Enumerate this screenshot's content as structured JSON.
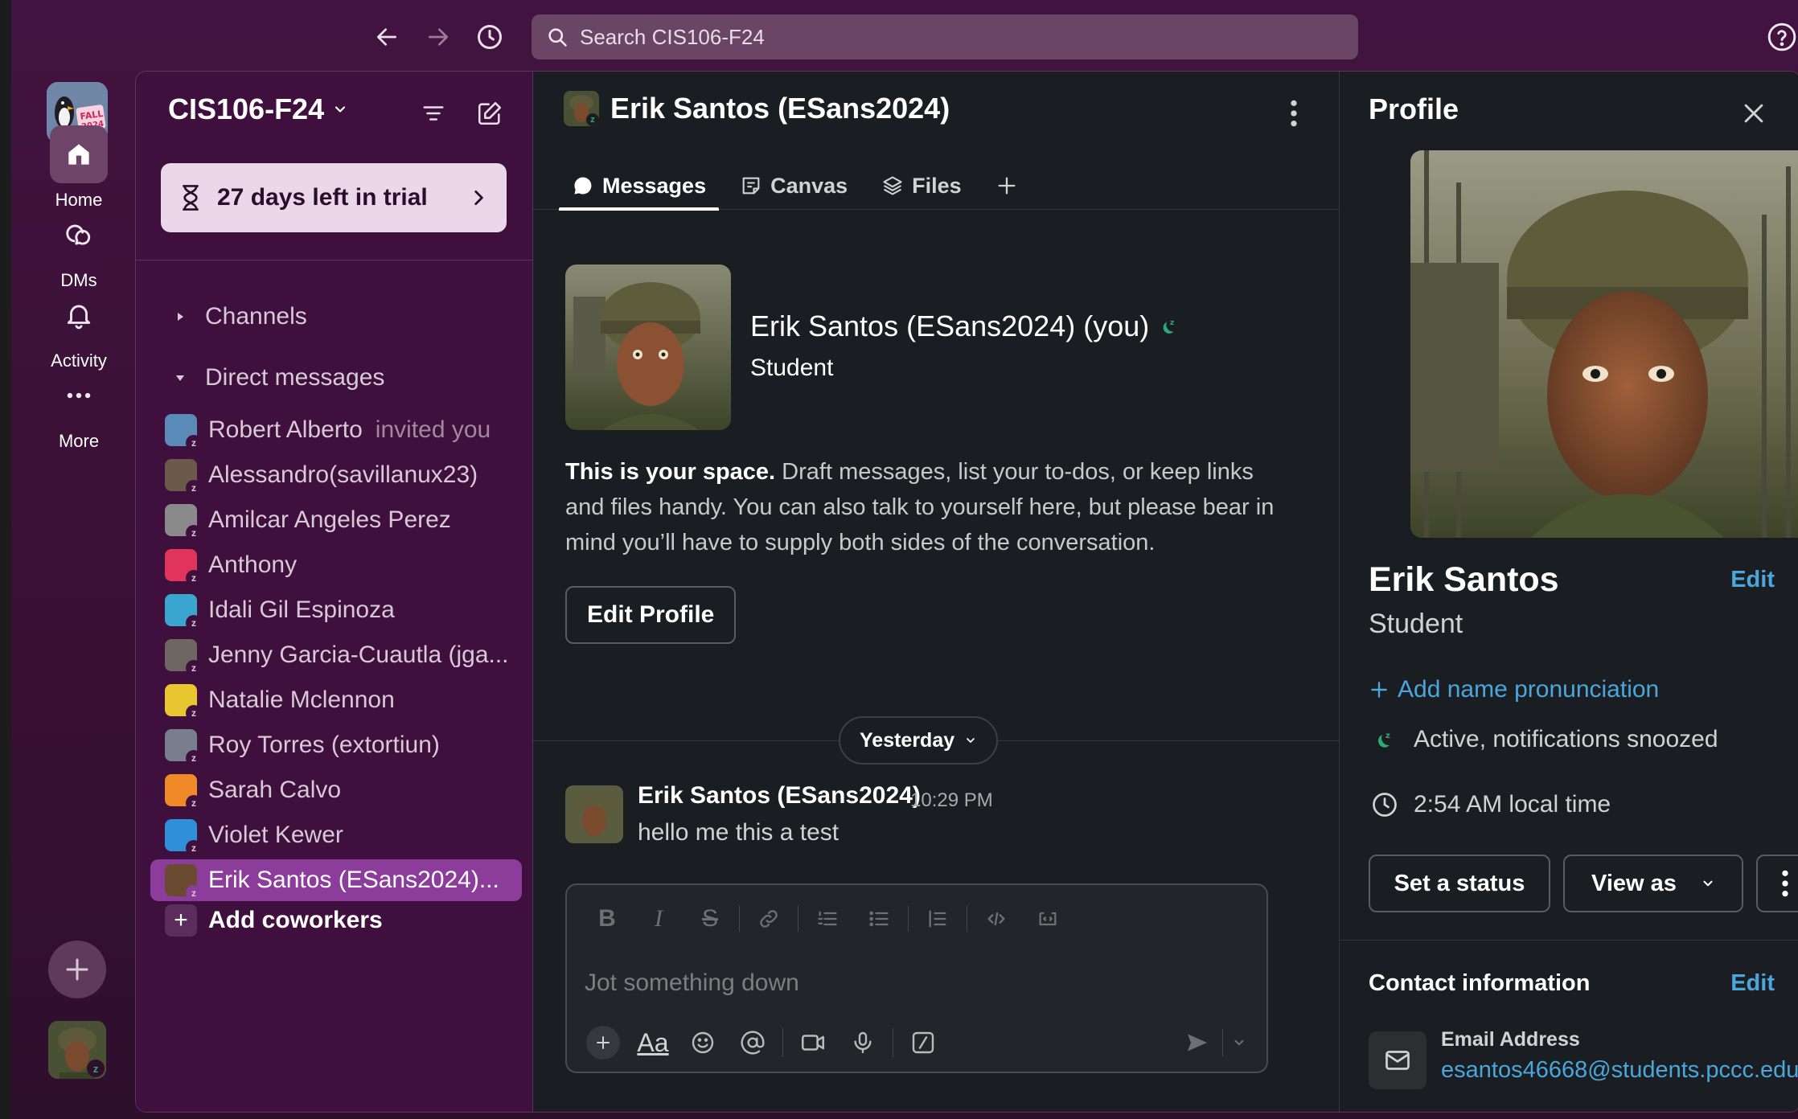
{
  "search": {
    "placeholder": "Search CIS106-F24"
  },
  "rail": {
    "workspace_logo_text": "FALL 2024",
    "items": [
      {
        "label": "Home",
        "icon": "home-icon"
      },
      {
        "label": "DMs",
        "icon": "dms-icon"
      },
      {
        "label": "Activity",
        "icon": "bell-icon"
      },
      {
        "label": "More",
        "icon": "more-dots-icon"
      }
    ]
  },
  "sidebar": {
    "workspace_name": "CIS106-F24",
    "trial_label": "27 days left in trial",
    "channels_label": "Channels",
    "dms_label": "Direct messages",
    "dms": [
      {
        "name": "Robert Alberto",
        "sub": "invited you",
        "color": "#5a8ab8"
      },
      {
        "name": "Alessandro(savillanux23)",
        "sub": "",
        "color": "#6b5a4a"
      },
      {
        "name": "Amilcar Angeles Perez",
        "sub": "",
        "color": "#8a8a8a"
      },
      {
        "name": "Anthony",
        "sub": "",
        "color": "#e0345c"
      },
      {
        "name": "Idali Gil Espinoza",
        "sub": "",
        "color": "#3aa6d0"
      },
      {
        "name": "Jenny Garcia-Cuautla (jga...",
        "sub": "",
        "color": "#6e6660"
      },
      {
        "name": "Natalie Mclennon",
        "sub": "",
        "color": "#e8c630"
      },
      {
        "name": "Roy Torres (extortiun)",
        "sub": "",
        "color": "#7a7e8c"
      },
      {
        "name": "Sarah Calvo",
        "sub": "",
        "color": "#f08a28"
      },
      {
        "name": "Violet Kewer",
        "sub": "",
        "color": "#2f8fd8"
      },
      {
        "name": "Erik Santos (ESans2024)...",
        "sub": "",
        "color": "#6a4a30"
      }
    ],
    "add_coworkers": "Add coworkers"
  },
  "conversation": {
    "title": "Erik Santos (ESans2024)",
    "tabs": [
      {
        "label": "Messages",
        "icon": "message-bubble-icon"
      },
      {
        "label": "Canvas",
        "icon": "canvas-icon"
      },
      {
        "label": "Files",
        "icon": "files-icon"
      }
    ],
    "intro_name": "Erik Santos (ESans2024) (you)",
    "intro_role": "Student",
    "intro_bold": "This is your space.",
    "intro_text": " Draft messages, list your to-dos, or keep links and files handy. You can also talk to yourself here, but please bear in mind you’ll have to supply both sides of the conversation.",
    "edit_profile": "Edit Profile",
    "day_divider": "Yesterday",
    "message": {
      "author": "Erik Santos (ESans2024)",
      "time": "10:29 PM",
      "text": "hello me this a test"
    },
    "composer_placeholder": "Jot something down",
    "format_text_icon_label": "Aa"
  },
  "profile": {
    "title": "Profile",
    "name": "Erik Santos",
    "edit": "Edit",
    "role": "Student",
    "pronunciation": "Add name pronunciation",
    "status": "Active, notifications snoozed",
    "local_time": "2:54 AM local time",
    "set_status": "Set a status",
    "view_as": "View as",
    "contact_title": "Contact information",
    "contact_edit": "Edit",
    "email_label": "Email Address",
    "email": "esantos46668@students.pccc.edu"
  },
  "colors": {
    "aubergine": "#3f0f3d",
    "active_item": "#8c3c9a",
    "link": "#4aa6db",
    "presence": "#2bac76"
  }
}
